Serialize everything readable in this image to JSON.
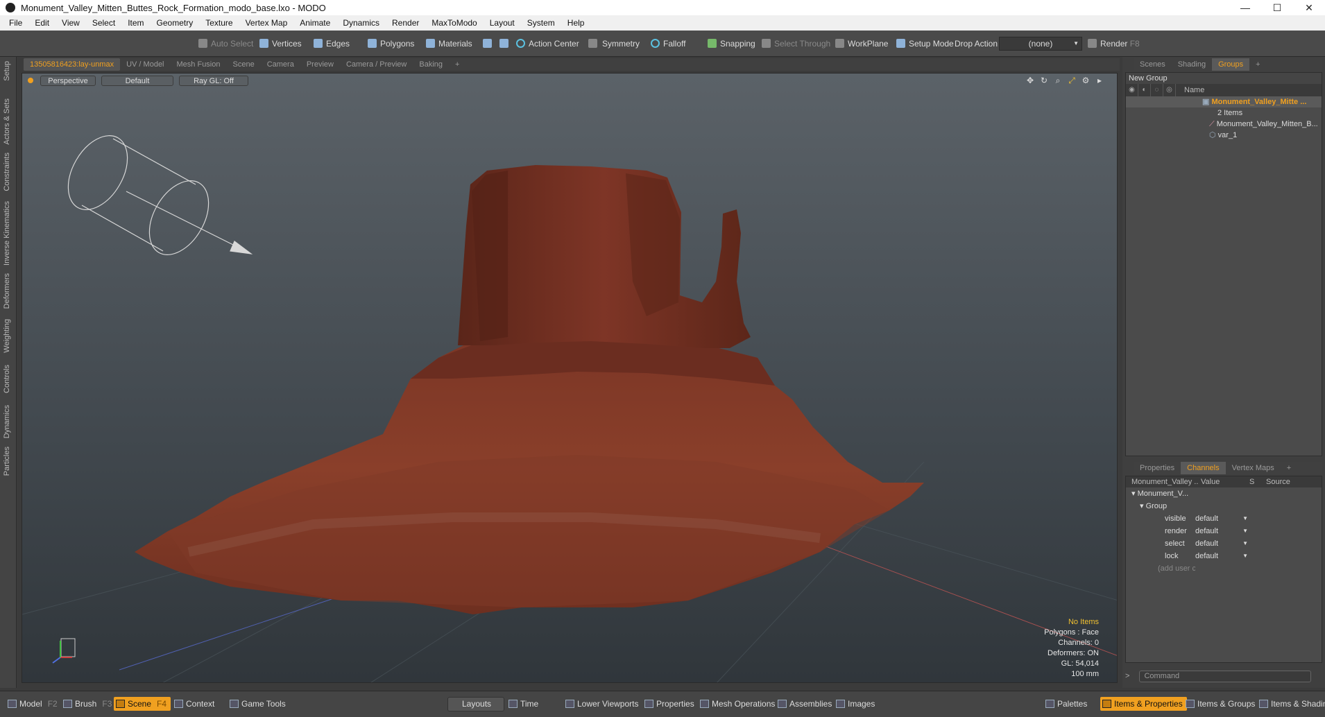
{
  "window": {
    "title": "Monument_Valley_Mitten_Buttes_Rock_Formation_modo_base.lxo - MODO",
    "min": "—",
    "max": "☐",
    "close": "✕"
  },
  "menu": [
    "File",
    "Edit",
    "View",
    "Select",
    "Item",
    "Geometry",
    "Texture",
    "Vertex Map",
    "Animate",
    "Dynamics",
    "Render",
    "MaxToModo",
    "Layout",
    "System",
    "Help"
  ],
  "toolbar": {
    "auto_select": "Auto Select",
    "vertices": "Vertices",
    "edges": "Edges",
    "polygons": "Polygons",
    "materials": "Materials",
    "action_center": "Action Center",
    "symmetry": "Symmetry",
    "falloff": "Falloff",
    "snapping": "Snapping",
    "select_through": "Select Through",
    "workplane": "WorkPlane",
    "setup_mode": "Setup Mode",
    "drop_action": "Drop Action",
    "drop_value": "(none)",
    "render": "Render",
    "render_key": "F8"
  },
  "left_tabs": [
    "Setup",
    "Actors & Sets",
    "Constraints",
    "Inverse Kinematics",
    "Deformers",
    "Weighting",
    "Controls",
    "Dynamics",
    "Particles"
  ],
  "view_tabs": [
    "13505816423:lay-unmax",
    "UV / Model",
    "Mesh Fusion",
    "Scene",
    "Camera",
    "Preview",
    "Camera / Preview",
    "Baking",
    "+"
  ],
  "viewport": {
    "perspective": "Perspective",
    "default": "Default",
    "raygl": "Ray GL: Off"
  },
  "info": {
    "items": "No Items",
    "polygons": "Polygons : Face",
    "channels": "Channels: 0",
    "deformers": "Deformers: ON",
    "gl": "GL: 54,014",
    "scale": "100 mm"
  },
  "right_tabs": [
    "Scenes",
    "Shading",
    "Groups",
    "+"
  ],
  "groups": {
    "new_group": "New Group",
    "name_col": "Name",
    "root": "Monument_Valley_Mitte ...",
    "count": "2 Items",
    "child1": "Monument_Valley_Mitten_B...",
    "child2": "var_1"
  },
  "prop_tabs": [
    "Properties",
    "Channels",
    "Vertex Maps",
    "+"
  ],
  "channels": {
    "head_name": "Monument_Valley ...",
    "head_value": "Value",
    "head_s": "S",
    "head_source": "Source",
    "item": "Monument_V...",
    "group": "Group",
    "rows": [
      {
        "name": "visible",
        "value": "default"
      },
      {
        "name": "render",
        "value": "default"
      },
      {
        "name": "select",
        "value": "default"
      },
      {
        "name": "lock",
        "value": "default"
      }
    ],
    "add": "(add user c..."
  },
  "command": "Command",
  "bottom": {
    "model": "Model",
    "f2": "F2",
    "brush": "Brush",
    "f3": "F3",
    "scene": "Scene",
    "f4": "F4",
    "context": "Context",
    "game_tools": "Game Tools",
    "layouts": "Layouts",
    "time": "Time",
    "lower_viewports": "Lower Viewports",
    "properties": "Properties",
    "mesh_operations": "Mesh Operations",
    "assemblies": "Assemblies",
    "images": "Images",
    "palettes": "Palettes",
    "items_properties": "Items & Properties",
    "items_groups": "Items & Groups",
    "items_shading": "Items & Shading"
  }
}
